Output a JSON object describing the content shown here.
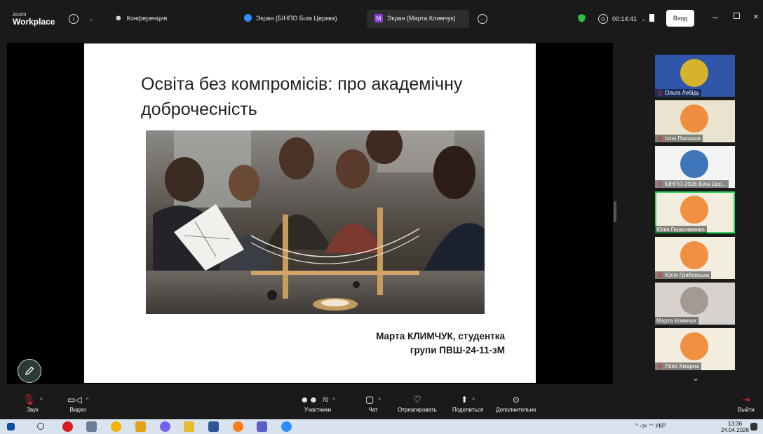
{
  "app": {
    "brand_top": "zoom",
    "brand_bottom": "Workplace"
  },
  "topbar": {
    "conference_label": "Конференция",
    "screen_tab_1": "Экран (БІНПО Біла Церква)",
    "screen_tab_2": "Экран (Марта Климчук)",
    "timer": "00:14:41",
    "login_label": "Вход"
  },
  "slide": {
    "title": "Освіта без компромісів: про академічну доброчесність",
    "author_line_1": "Марта КЛИМЧУК, студентка",
    "author_line_2": "групи ПВШ-24-11-зМ"
  },
  "participants": [
    {
      "name": "Ольга Лебідь",
      "bg": "#2f56a8",
      "accent": "#f2c314",
      "muted": true
    },
    {
      "name": "Ілля Пахомов",
      "bg": "#e9e3d0",
      "accent": "#f07f24",
      "muted": true
    },
    {
      "name": "БІНПО-2026 Біла Цер...",
      "bg": "#f4f4f4",
      "accent": "#1f5fb0",
      "muted": true
    },
    {
      "name": "Юлія Герасименко",
      "bg": "#f3ede0",
      "accent": "#f07f24",
      "muted": false
    },
    {
      "name": "Юлія Грибовська",
      "bg": "#f3ede0",
      "accent": "#f07f24",
      "muted": true
    },
    {
      "name": "Марта Климчук",
      "bg": "#d8d2cf",
      "accent": "#9b8f88",
      "muted": false
    },
    {
      "name": "Лілія Хмарна",
      "bg": "#f3ede0",
      "accent": "#f07f24",
      "muted": true
    }
  ],
  "toolbar": {
    "audio": "Звук",
    "video": "Видео",
    "participants": "Участники",
    "participants_count": "70",
    "chat": "Чат",
    "react": "Отреагировать",
    "share": "Поделиться",
    "more": "Дополнительно",
    "leave": "Выйти"
  },
  "taskbar": {
    "lang": "УКР",
    "time": "13:36",
    "date": "24.04.2026"
  },
  "colors": {
    "accent_green": "#2fd25a",
    "zoom_blue": "#2d8cff",
    "leave_red": "#e02828"
  }
}
